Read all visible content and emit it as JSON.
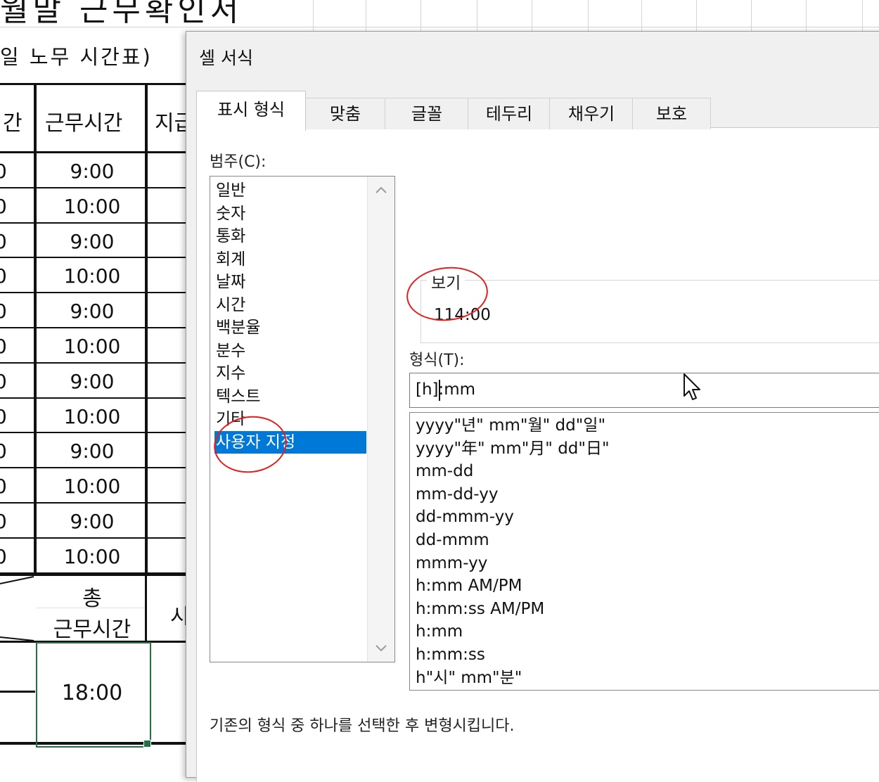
{
  "sheet": {
    "title": "월말 근무확인서",
    "subtitle": "일 노무 시간표)",
    "header_left_partial": "간",
    "header_work_time": "근무시간",
    "header_right_partial": "지급",
    "left_col_partial": "0",
    "work_times": [
      "9:00",
      "10:00",
      "9:00",
      "10:00",
      "9:00",
      "10:00",
      "9:00",
      "10:00",
      "9:00",
      "10:00",
      "9:00",
      "10:00"
    ],
    "total_label_line1": "총",
    "total_label_line2": "근무시간",
    "total_right_partial": "시",
    "total_value": "18:00"
  },
  "dialog": {
    "title": "셀 서식",
    "tabs": [
      "표시 형식",
      "맞춤",
      "글꼴",
      "테두리",
      "채우기",
      "보호"
    ],
    "active_tab": "표시 형식",
    "category_label": "범주(C):",
    "categories": [
      "일반",
      "숫자",
      "통화",
      "회계",
      "날짜",
      "시간",
      "백분율",
      "분수",
      "지수",
      "텍스트",
      "기타",
      "사용자 지정"
    ],
    "selected_category": "사용자 지정",
    "preview_label": "보기",
    "preview_value": "114:00",
    "format_label": "형식(T):",
    "format_value": "[h]:mm",
    "format_list": [
      "yyyy\"년\" mm\"월\" dd\"일\"",
      "yyyy\"年\" mm\"月\" dd\"日\"",
      "mm-dd",
      "mm-dd-yy",
      "dd-mmm-yy",
      "dd-mmm",
      "mmm-yy",
      "h:mm AM/PM",
      "h:mm:ss AM/PM",
      "h:mm",
      "h:mm:ss",
      "h\"시\" mm\"분\""
    ],
    "description": "기존의 형식 중 하나를 선택한 후 변형시킵니다."
  },
  "icons": {
    "scroll_up": "chevron-up-icon",
    "scroll_down": "chevron-down-icon",
    "cursor": "mouse-pointer-icon"
  },
  "colors": {
    "selection": "#0078d7",
    "annotation": "#e02020",
    "cell_border": "#217346"
  }
}
